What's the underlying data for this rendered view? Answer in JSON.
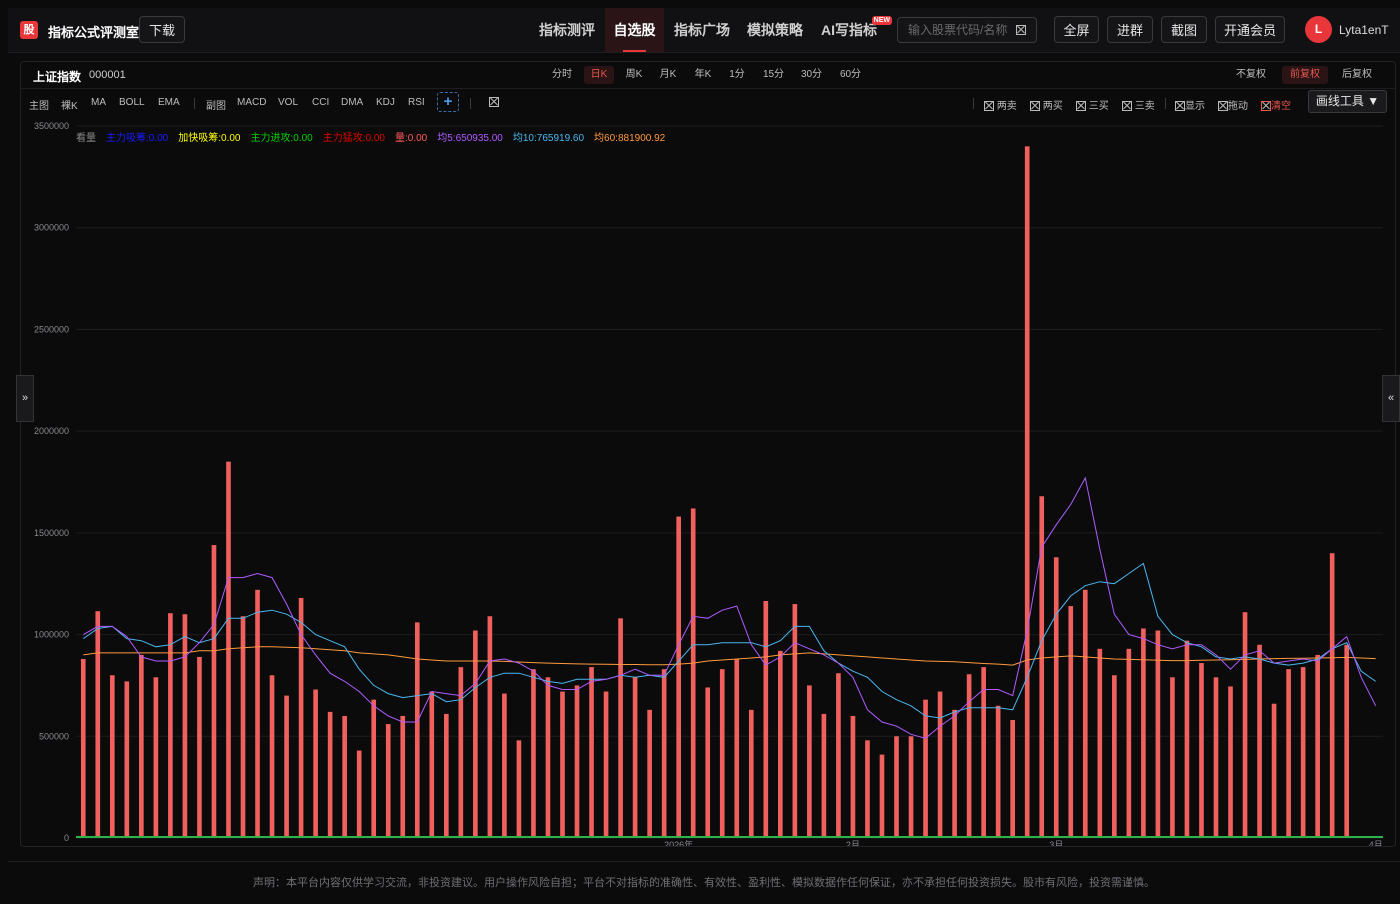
{
  "header": {
    "logo_glyph": "股",
    "brand": "指标公式评测室",
    "download_label": "下载",
    "nav": [
      {
        "label": "指标测评",
        "active": false
      },
      {
        "label": "自选股",
        "active": true
      },
      {
        "label": "指标广场",
        "active": false
      },
      {
        "label": "模拟策略",
        "active": false
      },
      {
        "label": "AI写指标",
        "active": false,
        "badge": "NEW"
      }
    ],
    "search_placeholder": "输入股票代码/名称",
    "buttons": {
      "fullscreen": "全屏",
      "join_group": "进群",
      "screenshot": "截图",
      "vip": "开通会员"
    },
    "user": {
      "avatar_letter": "L",
      "name": "Lyta1enT"
    }
  },
  "stock": {
    "name": "上证指数",
    "code": "000001"
  },
  "periods": [
    {
      "label": "分时",
      "active": false
    },
    {
      "label": "日K",
      "active": true
    },
    {
      "label": "周K",
      "active": false
    },
    {
      "label": "月K",
      "active": false
    },
    {
      "label": "年K",
      "active": false
    },
    {
      "label": "1分",
      "active": false
    },
    {
      "label": "15分",
      "active": false
    },
    {
      "label": "30分",
      "active": false
    },
    {
      "label": "60分",
      "active": false
    }
  ],
  "adjust": [
    {
      "label": "不复权",
      "active": false
    },
    {
      "label": "前复权",
      "active": true
    },
    {
      "label": "后复权",
      "active": false
    }
  ],
  "toolbar": {
    "main_label": "主图",
    "main_items": [
      "裸K",
      "MA",
      "BOLL",
      "EMA"
    ],
    "sub_label": "副图",
    "sub_items": [
      "MACD",
      "VOL",
      "CCI",
      "DMA",
      "KDJ",
      "RSI"
    ],
    "add_label": "+",
    "signals": [
      "两卖",
      "两买",
      "三买",
      "三卖",
      "显示",
      "拖动",
      "清空"
    ],
    "draw_tool_label": "画线工具 ▼"
  },
  "legend": [
    {
      "text": "看量",
      "color": "#8a8a8a"
    },
    {
      "text": "主力吸筹:0.00",
      "color": "#1a1aff"
    },
    {
      "text": "加快吸筹:0.00",
      "color": "#ffff00"
    },
    {
      "text": "主力进攻:0.00",
      "color": "#00d000"
    },
    {
      "text": "主力猛攻:0.00",
      "color": "#e00000"
    },
    {
      "text": "量:0.00",
      "color": "#ff5a5a"
    },
    {
      "text": "均5:650935.00",
      "color": "#b05cff"
    },
    {
      "text": "均10:765919.60",
      "color": "#4ab8f0"
    },
    {
      "text": "均60:881900.92",
      "color": "#ff9a3c"
    }
  ],
  "side_handles": {
    "left": "»",
    "right": "«"
  },
  "footer": "声明：本平台内容仅供学习交流，非投资建议。用户操作风险自担；平台不对指标的准确性、有效性、盈利性、模拟数据作任何保证，亦不承担任何投资损失。股市有风险，投资需谨慎。",
  "chart_data": {
    "type": "bar",
    "ylim": [
      0,
      3500000
    ],
    "yticks": [
      0,
      500000,
      1000000,
      1500000,
      2000000,
      2500000,
      3000000,
      3500000
    ],
    "ytick_labels": [
      "0",
      "500000",
      "1000000",
      "1500000",
      "2000000",
      "2500000",
      "3000000",
      "3500000"
    ],
    "xtick_labels": [
      {
        "label": "2026年",
        "index": 41
      },
      {
        "label": "2月",
        "index": 53
      },
      {
        "label": "3月",
        "index": 67
      },
      {
        "label": "4月",
        "index": 89
      }
    ],
    "grid": true,
    "colors": {
      "volume": "#f0605d",
      "ma5": "#b05cff",
      "ma10": "#4ab8f0",
      "ma60": "#ff9a3c",
      "baseline": "#2fb14a"
    },
    "volume": [
      880000,
      1115000,
      800000,
      770000,
      900000,
      790000,
      1105000,
      1100000,
      890000,
      1440000,
      1850000,
      1090000,
      1220000,
      800000,
      700000,
      1180000,
      730000,
      620000,
      600000,
      430000,
      680000,
      560000,
      600000,
      1060000,
      720000,
      610000,
      840000,
      1020000,
      1090000,
      710000,
      480000,
      830000,
      790000,
      720000,
      750000,
      840000,
      720000,
      1080000,
      790000,
      630000,
      830000,
      1580000,
      1620000,
      740000,
      830000,
      880000,
      630000,
      1165000,
      920000,
      1150000,
      750000,
      610000,
      810000,
      600000,
      480000,
      410000,
      500000,
      500000,
      680000,
      720000,
      630000,
      805000,
      840000,
      650000,
      580000,
      3400000,
      1680000,
      1380000,
      1140000,
      1220000,
      930000,
      800000,
      930000,
      1030000,
      1020000,
      790000,
      970000,
      860000,
      790000,
      745000,
      1110000,
      950000,
      660000,
      830000,
      840000,
      900000,
      1400000,
      950000,
      0,
      0
    ],
    "ma5": [
      1000000,
      1040000,
      1040000,
      990000,
      890000,
      870000,
      870000,
      890000,
      960000,
      1050000,
      1280000,
      1280000,
      1300000,
      1280000,
      1150000,
      1000000,
      900000,
      810000,
      770000,
      720000,
      650000,
      600000,
      570000,
      570000,
      720000,
      710000,
      700000,
      760000,
      870000,
      880000,
      860000,
      820000,
      750000,
      730000,
      730000,
      770000,
      780000,
      800000,
      830000,
      800000,
      800000,
      950000,
      1090000,
      1080000,
      1120000,
      1140000,
      950000,
      850000,
      890000,
      960000,
      930000,
      900000,
      860000,
      790000,
      630000,
      570000,
      550000,
      510000,
      490000,
      550000,
      600000,
      670000,
      730000,
      730000,
      700000,
      1020000,
      1430000,
      1540000,
      1640000,
      1770000,
      1420000,
      1100000,
      1000000,
      980000,
      950000,
      930000,
      950000,
      950000,
      900000,
      830000,
      900000,
      920000,
      860000,
      870000,
      880000,
      870000,
      930000,
      990000,
      790000,
      650000
    ],
    "ma10": [
      980000,
      1030000,
      1040000,
      980000,
      970000,
      940000,
      950000,
      990000,
      960000,
      980000,
      1080000,
      1080000,
      1110000,
      1120000,
      1100000,
      1060000,
      1000000,
      970000,
      940000,
      830000,
      750000,
      710000,
      690000,
      700000,
      710000,
      670000,
      680000,
      740000,
      790000,
      810000,
      810000,
      790000,
      770000,
      760000,
      780000,
      780000,
      780000,
      800000,
      790000,
      800000,
      790000,
      870000,
      950000,
      950000,
      960000,
      960000,
      960000,
      940000,
      970000,
      1040000,
      1040000,
      920000,
      860000,
      820000,
      790000,
      720000,
      680000,
      650000,
      600000,
      590000,
      620000,
      640000,
      640000,
      640000,
      630000,
      790000,
      970000,
      1100000,
      1190000,
      1240000,
      1260000,
      1250000,
      1300000,
      1350000,
      1090000,
      1000000,
      960000,
      940000,
      890000,
      880000,
      890000,
      880000,
      860000,
      850000,
      860000,
      880000,
      930000,
      960000,
      820000,
      770000
    ],
    "ma60": [
      900000,
      910000,
      910000,
      910000,
      910000,
      910000,
      910000,
      910000,
      920000,
      920000,
      930000,
      935000,
      940000,
      940000,
      938000,
      935000,
      930000,
      925000,
      920000,
      910000,
      905000,
      900000,
      890000,
      880000,
      875000,
      870000,
      870000,
      870000,
      870000,
      868000,
      865000,
      862000,
      860000,
      858000,
      856000,
      855000,
      854000,
      853000,
      853000,
      852000,
      852000,
      855000,
      860000,
      870000,
      875000,
      880000,
      885000,
      890000,
      900000,
      905000,
      910000,
      905000,
      900000,
      895000,
      890000,
      885000,
      880000,
      875000,
      870000,
      868000,
      866000,
      862000,
      858000,
      855000,
      850000,
      875000,
      885000,
      890000,
      895000,
      890000,
      885000,
      880000,
      878000,
      876000,
      874000,
      872000,
      872000,
      874000,
      875000,
      876000,
      878000,
      880000,
      882000,
      883000,
      884000,
      885000,
      886000,
      888000,
      885000,
      882000
    ]
  }
}
